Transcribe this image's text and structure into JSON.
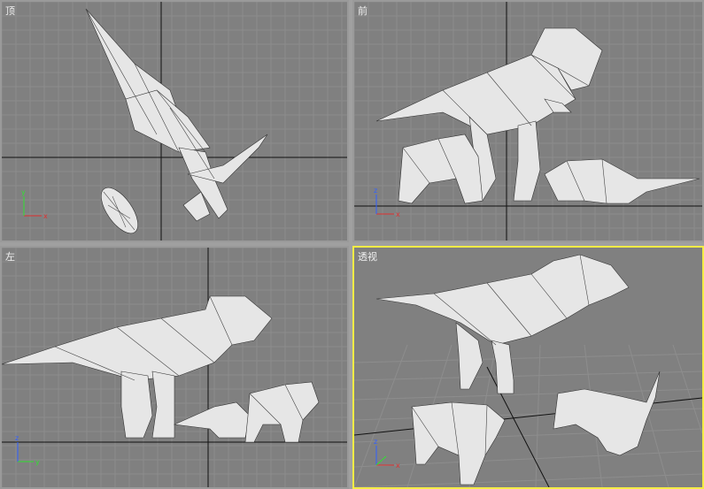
{
  "viewports": {
    "top": {
      "label": "顶"
    },
    "front": {
      "label": "前"
    },
    "left": {
      "label": "左"
    },
    "perspective": {
      "label": "透视",
      "active": true
    }
  },
  "axes": {
    "x": "x",
    "y": "y",
    "z": "z"
  },
  "colors": {
    "background": "#808080",
    "grid_line": "#8c8c8c",
    "grid_major": "#000000",
    "active_border": "#f4ec45",
    "mesh_fill": "#e8e8e8",
    "axis_x": "#e03030",
    "axis_y": "#30e030",
    "axis_z": "#3060ff"
  }
}
